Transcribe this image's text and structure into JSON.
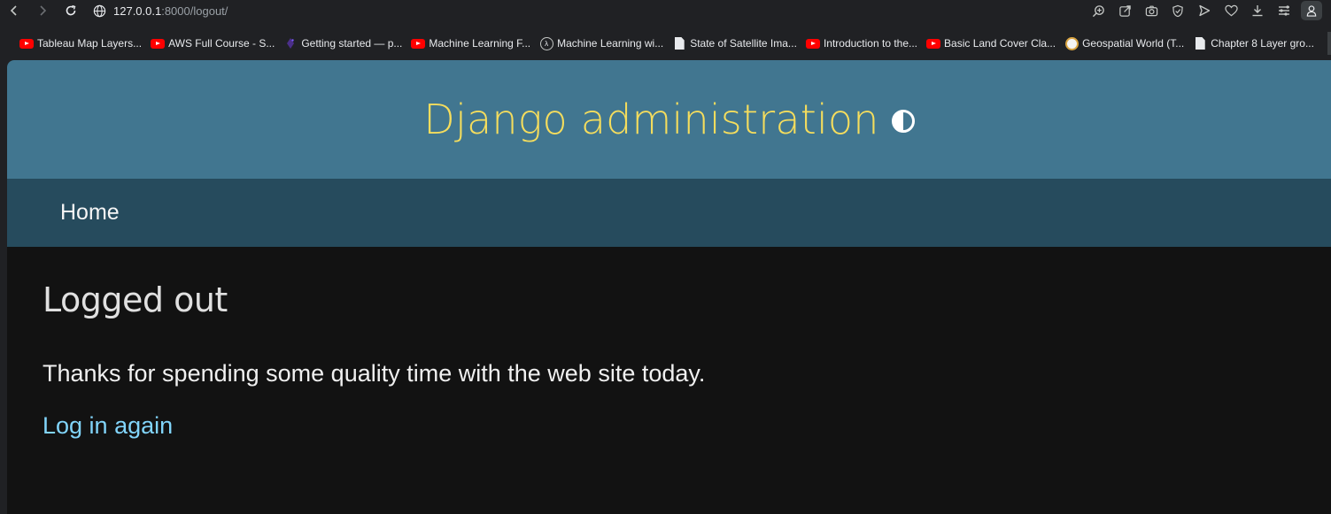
{
  "browser": {
    "url_host": "127.0.0.1",
    "url_rest": ":8000/logout/",
    "bookmarks": [
      {
        "label": "Tableau Map Layers...",
        "icon": "youtube-icon"
      },
      {
        "label": "AWS Full Course - S...",
        "icon": "youtube-icon"
      },
      {
        "label": "Getting started — p...",
        "icon": "pytorch-icon"
      },
      {
        "label": "Machine Learning F...",
        "icon": "youtube-icon"
      },
      {
        "label": "Machine Learning wi...",
        "icon": "lambda-icon"
      },
      {
        "label": "State of Satellite Ima...",
        "icon": "document-icon"
      },
      {
        "label": "Introduction to the...",
        "icon": "youtube-icon"
      },
      {
        "label": "Basic Land Cover Cla...",
        "icon": "youtube-icon"
      },
      {
        "label": "Geospatial World (T...",
        "icon": "geospatial-icon"
      },
      {
        "label": "Chapter 8 Layer gro...",
        "icon": "document-icon"
      }
    ]
  },
  "header": {
    "site_name": "Django administration"
  },
  "breadcrumbs": {
    "home_label": "Home"
  },
  "main": {
    "title": "Logged out",
    "message": "Thanks for spending some quality time with the web site today.",
    "login_link": "Log in again"
  },
  "colors": {
    "header_bg": "#417690",
    "title": "#f5dd5d",
    "breadcrumb_bg": "#264b5d",
    "link": "#81d4fa"
  }
}
